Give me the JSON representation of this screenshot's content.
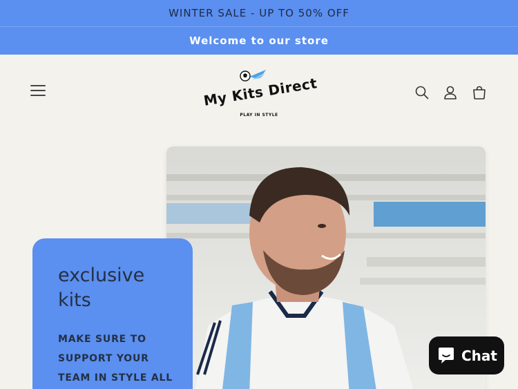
{
  "announcement": {
    "sale_text": "WINTER SALE - UP TO 50% OFF",
    "welcome_text": "Welcome to our store"
  },
  "header": {
    "brand_name": "My Kits Direct",
    "brand_tagline": "PLAY IN STYLE",
    "icons": [
      "menu-icon",
      "search-icon",
      "account-icon",
      "cart-icon"
    ]
  },
  "hero": {
    "heading": "exclusive kits",
    "subtext": "MAKE SURE TO SUPPORT YOUR TEAM IN STYLE ALL"
  },
  "chat_widget": {
    "label": "Chat"
  },
  "colors": {
    "accent": "#5b8ff0",
    "background": "#f3f2ec",
    "chat": "#111111"
  }
}
